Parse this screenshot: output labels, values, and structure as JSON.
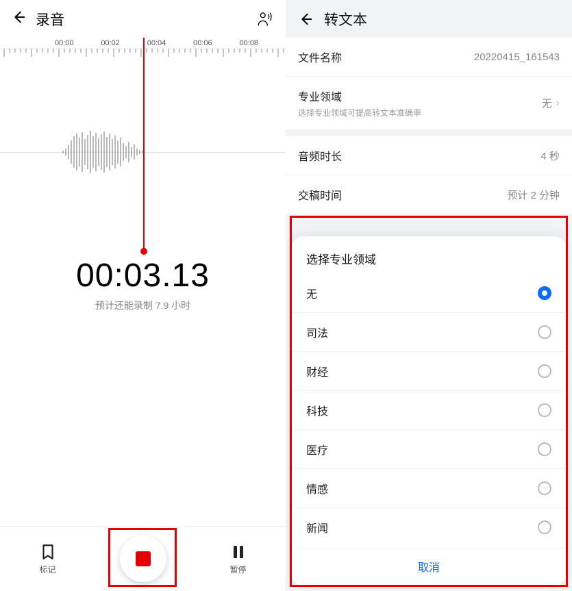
{
  "left": {
    "title": "录音",
    "ruler": [
      "00:00",
      "00:02",
      "00:04",
      "00:06",
      "00:08"
    ],
    "timer": "00:03.13",
    "remain": "预计还能录制 7.9 小时",
    "bottom": {
      "mark": "标记",
      "pause": "暂停"
    }
  },
  "right": {
    "title": "转文本",
    "rows": {
      "filename_k": "文件名称",
      "filename_v": "20220415_161543",
      "domain_k": "专业领域",
      "domain_sub": "选择专业领域可提高转文本准确率",
      "domain_v": "无",
      "duration_k": "音频时长",
      "duration_v": "4 秒",
      "deliver_k": "交稿时间",
      "deliver_v": "预计 2 分钟"
    },
    "sheet": {
      "title": "选择专业领域",
      "options": [
        "无",
        "司法",
        "财经",
        "科技",
        "医疗",
        "情感",
        "新闻"
      ],
      "selected": 0,
      "cancel": "取消"
    }
  }
}
